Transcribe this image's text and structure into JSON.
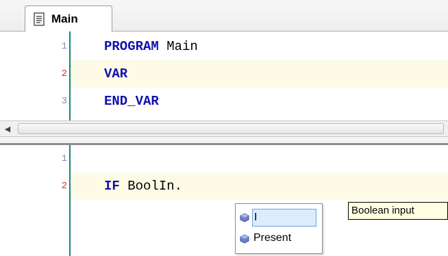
{
  "tab": {
    "label": "Main",
    "icon": "document-icon"
  },
  "declaration": {
    "lines": [
      {
        "number": "1",
        "keyword": "PROGRAM",
        "rest": " Main",
        "modified": false
      },
      {
        "number": "2",
        "keyword": "VAR",
        "rest": "",
        "modified": true
      },
      {
        "number": "3",
        "keyword": "END_VAR",
        "rest": "",
        "modified": false
      }
    ]
  },
  "body": {
    "lines": [
      {
        "number": "1",
        "keyword": "",
        "rest": "",
        "modified": false
      },
      {
        "number": "2",
        "keyword": "IF",
        "rest": " BoolIn.",
        "modified": true
      }
    ]
  },
  "scrollbar": {
    "left_arrow": "◀"
  },
  "autocomplete": {
    "items": [
      {
        "label": "I",
        "icon": "member-icon",
        "selected": true
      },
      {
        "label": "Present",
        "icon": "member-icon",
        "selected": false
      }
    ],
    "tooltip": "Boolean input"
  },
  "colors": {
    "keyword": "#1010b0",
    "gutter_line": "#10867a",
    "modified_line_number": "#d03030",
    "line_number": "#7a96b0",
    "highlight": "#fdfbe6"
  }
}
